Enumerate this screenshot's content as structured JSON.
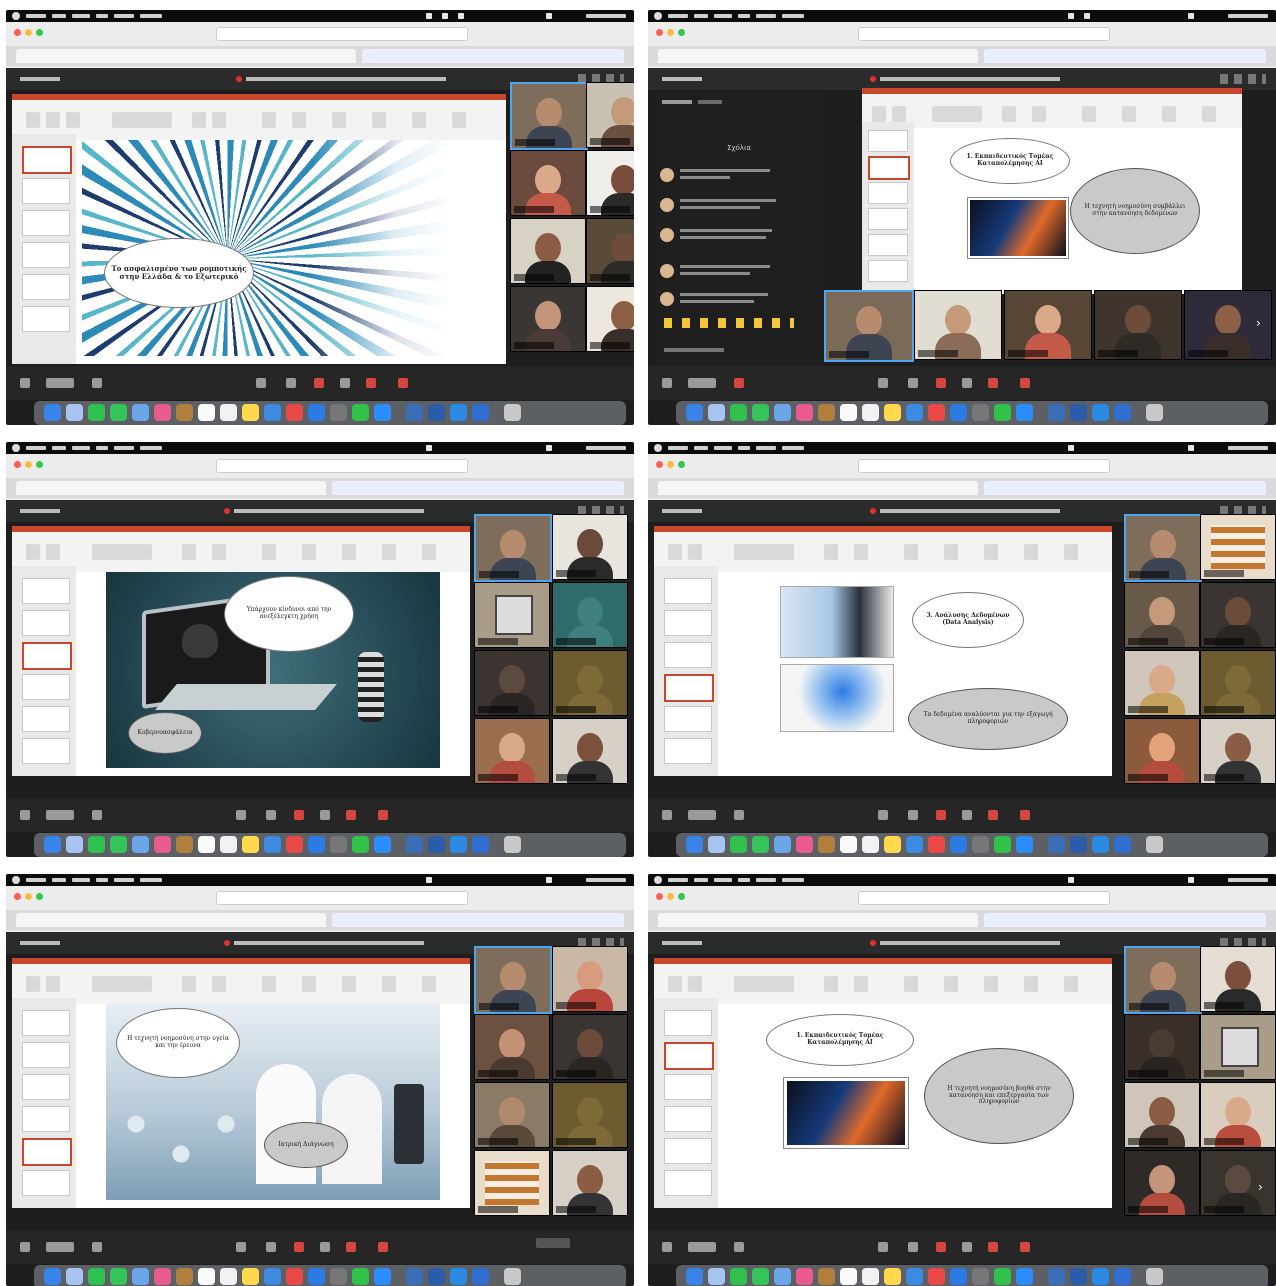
{
  "panels": [
    {
      "id": "panel-1",
      "bubble_text": "Το ασφαλισμένο των ρομποτικής στην Ελλάδα & το Εξωτερικό",
      "tiles": 8
    },
    {
      "id": "panel-2",
      "bubble_main": "1. Εκπαιδευτικός Τομέας Καταπολέμησης ΑΙ",
      "bubble_side": "Η τεχνητή νοημοσύνη συμβάλλει στην κατανόηση δεδομένων",
      "chat_header": "Σχόλια",
      "tiles": 5
    },
    {
      "id": "panel-3",
      "bubble_main": "Υπάρχουν κίνδυνοι από την ανεξέλεγκτη χρήση",
      "bubble_small": "Κυβερνοασφάλεια",
      "tiles": 8
    },
    {
      "id": "panel-4",
      "bubble_main": "3. Ανάλυσης Δεδομένων (Data Analysis)",
      "bubble_side": "Τα δεδομένα αναλύονται για την εξαγωγή πληροφοριών",
      "tiles": 8
    },
    {
      "id": "panel-5",
      "bubble_main": "Η τεχνητή νοημοσύνη στην υγεία και την έρευνα",
      "bubble_small": "Ιατρική Διάγνωση",
      "tiles": 8
    },
    {
      "id": "panel-6",
      "bubble_main": "1. Εκπαιδευτικός Τομέας Καταπολέμησης ΑΙ",
      "bubble_side": "Η τεχνητή νοημοσύνη βοηθά στην κατανόηση και επεξεργασία των πληροφοριών",
      "tiles": 8
    }
  ],
  "colors": {
    "accent": "#c9472b",
    "zoom_bg": "#1e1e1e",
    "active_border": "#4ea6f0"
  }
}
